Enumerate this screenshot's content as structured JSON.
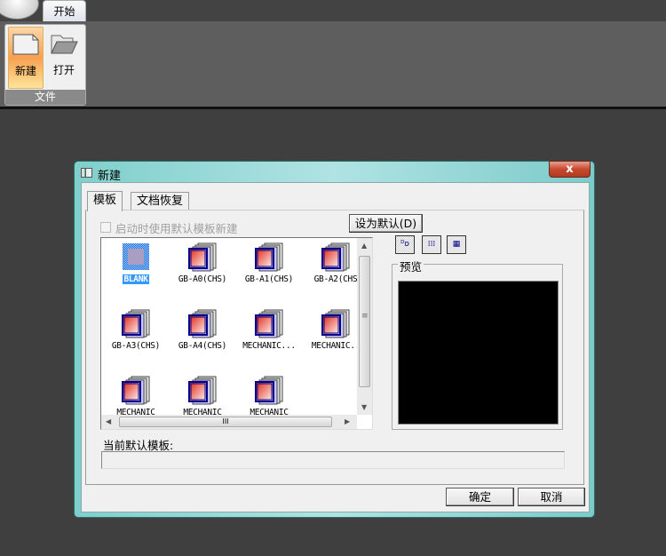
{
  "ribbon": {
    "tab": "开始",
    "group_label": "文件",
    "new_label": "新建",
    "open_label": "打开"
  },
  "dialog": {
    "title": "新建",
    "close": "x",
    "tabs": [
      "模板",
      "文档恢复"
    ],
    "checkbox_label": "启动时使用默认模板新建",
    "checkbox_checked": false,
    "set_default_button": "设为默认(D)",
    "templates": [
      {
        "name": "BLANK",
        "selected": true
      },
      {
        "name": "GB-A0(CHS)"
      },
      {
        "name": "GB-A1(CHS)"
      },
      {
        "name": "GB-A2(CHS"
      },
      {
        "name": "GB-A3(CHS)"
      },
      {
        "name": "GB-A4(CHS)"
      },
      {
        "name": "MECHANIC..."
      },
      {
        "name": "MECHANIC.."
      },
      {
        "name": "MECHANIC"
      },
      {
        "name": "MECHANIC"
      },
      {
        "name": "MECHANIC"
      }
    ],
    "hscroll_grip": "III",
    "vscroll_grip": "≡",
    "preview_label": "预览",
    "current_default_label": "当前默认模板:",
    "current_default_value": "",
    "ok": "确定",
    "cancel": "取消"
  }
}
